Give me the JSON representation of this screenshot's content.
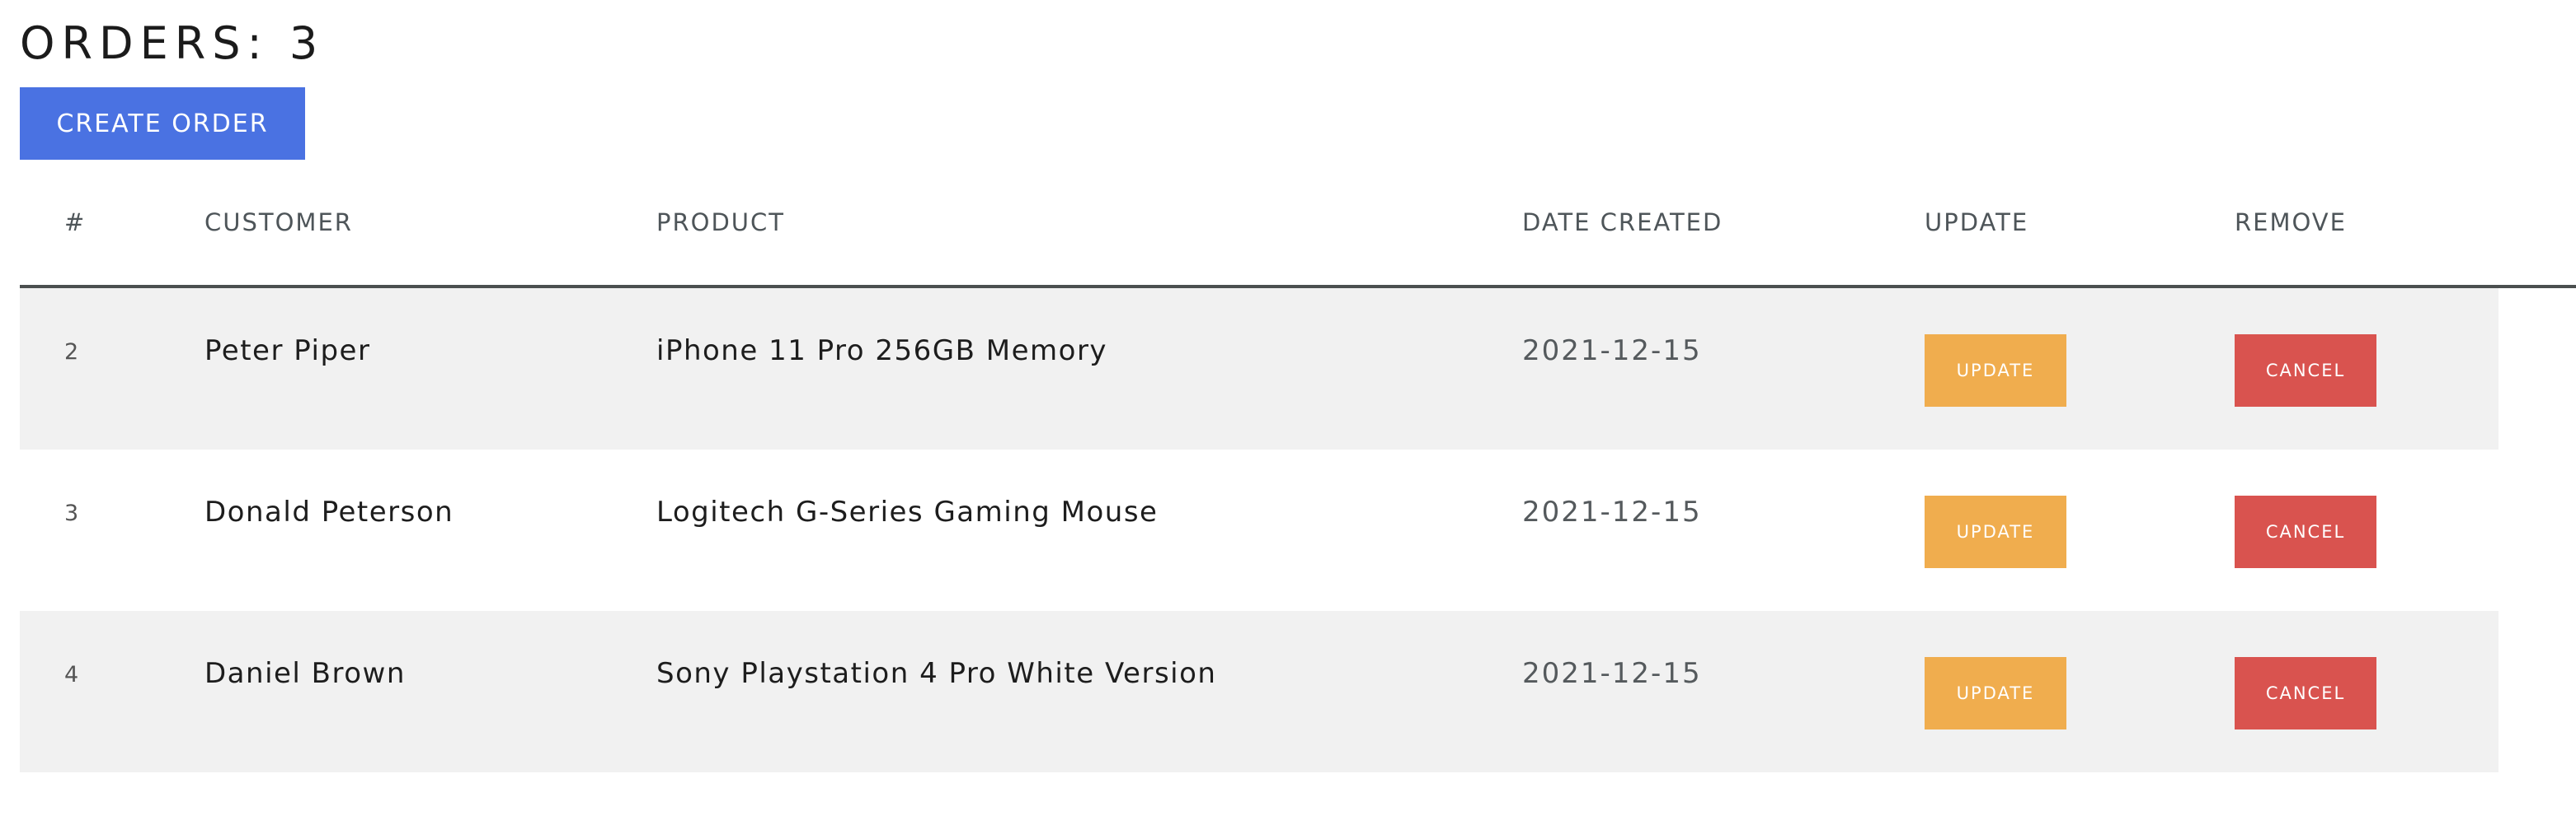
{
  "page": {
    "title_prefix": "ORDERS: ",
    "order_count": "3"
  },
  "toolbar": {
    "create_label": "CREATE ORDER"
  },
  "table": {
    "headers": {
      "id": "#",
      "customer": "CUSTOMER",
      "product": "PRODUCT",
      "date": "DATE CREATED",
      "update": "UPDATE",
      "remove": "REMOVE"
    },
    "rows": [
      {
        "id": "2",
        "customer": "Peter Piper",
        "product": "iPhone 11 Pro 256GB Memory",
        "date": "2021-12-15",
        "update_label": "UPDATE",
        "cancel_label": "CANCEL"
      },
      {
        "id": "3",
        "customer": "Donald Peterson",
        "product": "Logitech G-Series Gaming Mouse",
        "date": "2021-12-15",
        "update_label": "UPDATE",
        "cancel_label": "CANCEL"
      },
      {
        "id": "4",
        "customer": "Daniel Brown",
        "product": "Sony Playstation 4 Pro White Version",
        "date": "2021-12-15",
        "update_label": "UPDATE",
        "cancel_label": "CANCEL"
      }
    ]
  },
  "colors": {
    "primary": "#4a72e2",
    "update": "#f0ad4e",
    "cancel": "#d9534f",
    "row_shade": "#f1f1f1"
  }
}
